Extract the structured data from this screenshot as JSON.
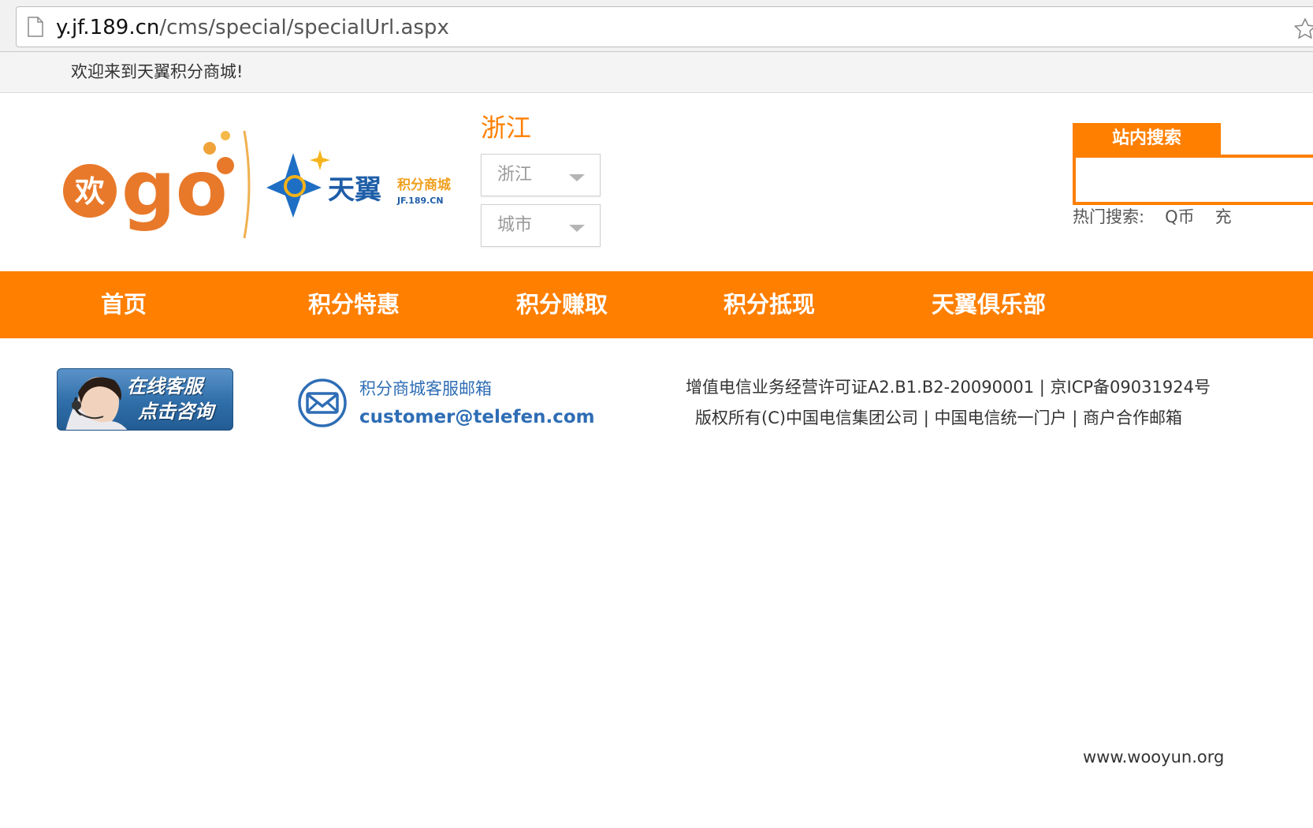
{
  "browser": {
    "url_host": "y.jf.189.cn",
    "url_path": "/cms/special/specialUrl.aspx"
  },
  "welcome": {
    "text": "欢迎来到天翼积分商城!"
  },
  "header": {
    "region_title": "浙江",
    "province_select": {
      "value": "浙江"
    },
    "city_select": {
      "value": "城市"
    },
    "search": {
      "tab_label": "站内搜索",
      "hot_label": "热门搜索:",
      "hot_links": [
        "Q币",
        "充"
      ]
    }
  },
  "nav": {
    "items": [
      "首页",
      "积分特惠",
      "积分赚取",
      "积分抵现",
      "天翼俱乐部"
    ]
  },
  "footer": {
    "service": {
      "line1": "在线客服",
      "line2": "点击咨询"
    },
    "mail": {
      "title": "积分商城客服邮箱",
      "address": "customer@telefen.com"
    },
    "license": {
      "permit": "增值电信业务经营许可证A2.B1.B2-20090001",
      "separator": "|",
      "icp": "京ICP备09031924号"
    },
    "links": [
      "版权所有(C)中国电信集团公司",
      "中国电信统一门户",
      "商户合作邮箱"
    ]
  },
  "watermark": "www.wooyun.org",
  "colors": {
    "accent": "#ff7f00",
    "link_blue": "#2e6db5"
  },
  "icons": [
    "page-icon",
    "bookmark-star-icon",
    "chevron-down-icon",
    "mail-icon",
    "headset-agent-icon"
  ]
}
